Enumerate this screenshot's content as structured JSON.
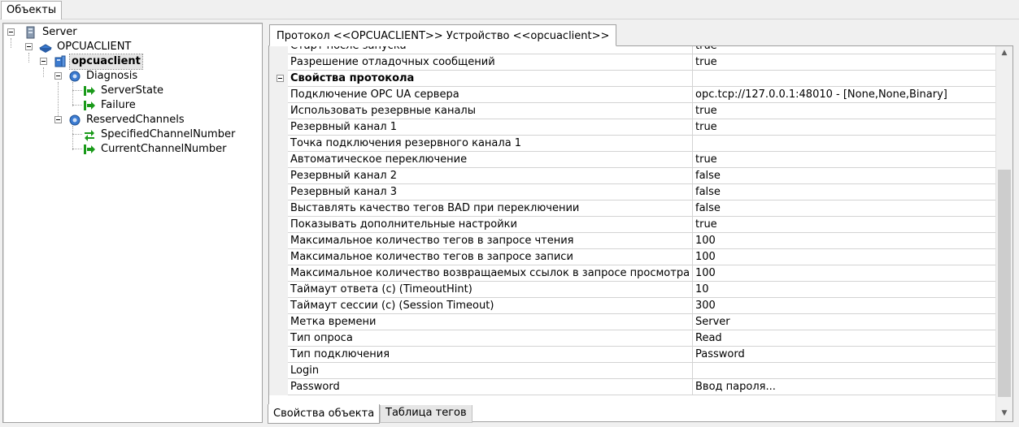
{
  "top_tab": {
    "label": "Объекты"
  },
  "tree": {
    "server": "Server",
    "opcuaclient_group": "OPCUACLIENT",
    "device": "opcuaclient",
    "diagnosis": "Diagnosis",
    "server_state": "ServerState",
    "failure": "Failure",
    "reserved_channels": "ReservedChannels",
    "specified_channel": "SpecifiedChannelNumber",
    "current_channel": "CurrentChannelNumber"
  },
  "protocol_tab": {
    "label": "Протокол <<OPCUACLIENT>> Устройство <<opcuaclient>>"
  },
  "properties": {
    "rows": [
      {
        "name": "Старт после запуска",
        "value": "true"
      },
      {
        "name": "Разрешение отладочных сообщений",
        "value": "true"
      },
      {
        "name": "Свойства протокола",
        "value": ""
      },
      {
        "name": "Подключение OPC UA сервера",
        "value": "opc.tcp://127.0.0.1:48010 - [None,None,Binary]"
      },
      {
        "name": "Использовать резервные каналы",
        "value": "true"
      },
      {
        "name": "Резервный канал 1",
        "value": "true"
      },
      {
        "name": "Точка подключения резервного канала 1",
        "value": ""
      },
      {
        "name": "Автоматическое переключение",
        "value": "true"
      },
      {
        "name": "Резервный канал 2",
        "value": "false"
      },
      {
        "name": "Резервный канал 3",
        "value": "false"
      },
      {
        "name": "Выставлять качество тегов BAD при переключении",
        "value": "false"
      },
      {
        "name": "Показывать дополнительные настройки",
        "value": "true"
      },
      {
        "name": "Максимальное количество тегов в запросе чтения",
        "value": "100"
      },
      {
        "name": "Максимальное количество тегов в запросе записи",
        "value": "100"
      },
      {
        "name": "Максимальное количество возвращаемых ссылок в запросе просмотра",
        "value": "100"
      },
      {
        "name": "Таймаут ответа (с) (TimeoutHint)",
        "value": "10"
      },
      {
        "name": "Таймаут сессии (с) (Session Timeout)",
        "value": "300"
      },
      {
        "name": "Метка времени",
        "value": "Server"
      },
      {
        "name": "Тип опроса",
        "value": "Read"
      },
      {
        "name": "Тип подключения",
        "value": "Password"
      },
      {
        "name": "Login",
        "value": ""
      },
      {
        "name": "Password",
        "value": "Ввод пароля..."
      }
    ]
  },
  "bottom_tabs": {
    "object_props": "Свойства объекта",
    "tag_table": "Таблица тегов"
  },
  "colors": {
    "folder_blue": "#3b7bd1",
    "arrow_green": "#1a9a1a",
    "grid_line": "#d3d3d3"
  }
}
